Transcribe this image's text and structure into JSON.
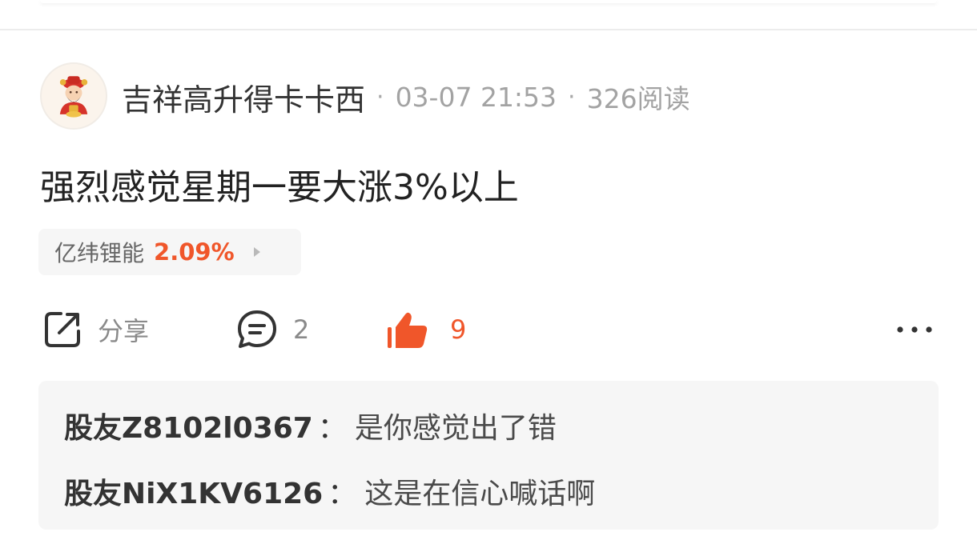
{
  "post": {
    "author": "吉祥高升得卡卡西",
    "separator": "·",
    "timestamp": "03-07 21:53",
    "reads": "326阅读",
    "content": "强烈感觉星期一要大涨3%以上",
    "stock": {
      "name": "亿纬锂能",
      "change": "2.09%",
      "change_color": "#f0562a"
    },
    "actions": {
      "share_label": "分享",
      "share_icon": "share-icon",
      "comment_count": "2",
      "comment_icon": "comment-icon",
      "like_count": "9",
      "like_icon": "thumbs-up-icon",
      "like_color": "#f0562a",
      "more_icon": "more-icon"
    },
    "replies": [
      {
        "user": "股友Z8102l0367",
        "colon": "：",
        "text": "是你感觉出了错"
      },
      {
        "user": "股友NiX1KV6126",
        "colon": "：",
        "text": "这是在信心喊话啊"
      }
    ]
  }
}
